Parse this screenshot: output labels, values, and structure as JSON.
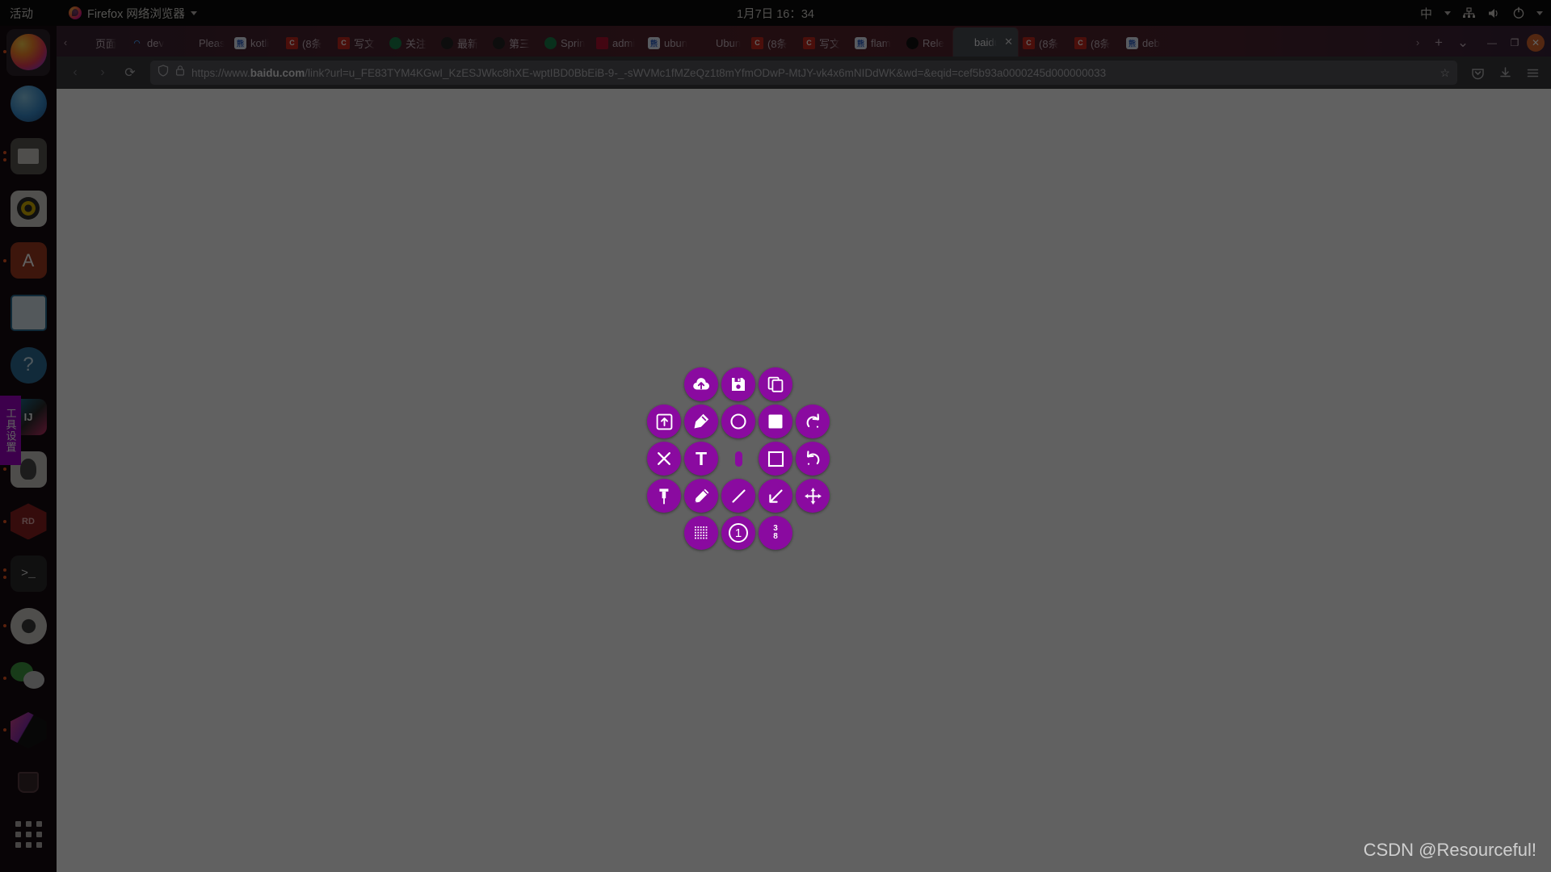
{
  "topbar": {
    "activities": "活动",
    "app_name": "Firefox 网络浏览器",
    "clock": "1月7日  16：34",
    "input_method": "中",
    "icons": [
      "network-icon",
      "volume-icon",
      "power-icon",
      "chevron-down-icon"
    ]
  },
  "dock": {
    "tool_tag": "工具设置",
    "items": [
      {
        "name": "firefox",
        "label": "Firefox"
      },
      {
        "name": "thunderbird",
        "label": "Thunderbird"
      },
      {
        "name": "files",
        "label": "Files"
      },
      {
        "name": "rhythmbox",
        "label": "Rhythmbox"
      },
      {
        "name": "ubuntu-software",
        "label": "Ubuntu Software"
      },
      {
        "name": "libreoffice-impress",
        "label": "LibreOffice Impress"
      },
      {
        "name": "help",
        "label": "Help"
      },
      {
        "name": "intellij-idea",
        "label": "IntelliJ IDEA"
      },
      {
        "name": "dbeaver",
        "label": "DBeaver"
      },
      {
        "name": "redis-desktop-manager",
        "label": "RDM"
      },
      {
        "name": "terminal",
        "label": "Terminal"
      },
      {
        "name": "settings",
        "label": "Settings"
      },
      {
        "name": "wechat",
        "label": "WeChat"
      },
      {
        "name": "virtualbox",
        "label": "VirtualBox"
      },
      {
        "name": "trash",
        "label": "Trash"
      },
      {
        "name": "show-applications",
        "label": "Show Applications"
      }
    ]
  },
  "browser": {
    "tabs": [
      {
        "label": "页面",
        "favicon": "none",
        "selected": false
      },
      {
        "label": "dev",
        "favicon": "load",
        "selected": false
      },
      {
        "label": "Please s",
        "favicon": "none",
        "selected": false
      },
      {
        "label": "kotli",
        "favicon": "baidu",
        "selected": false
      },
      {
        "label": "(8条",
        "favicon": "csdn",
        "selected": false
      },
      {
        "label": "写文",
        "favicon": "csdn",
        "selected": false
      },
      {
        "label": "关注",
        "favicon": "green",
        "selected": false
      },
      {
        "label": "最新",
        "favicon": "dark",
        "selected": false
      },
      {
        "label": "第三",
        "favicon": "dark",
        "selected": false
      },
      {
        "label": "Sprin",
        "favicon": "green",
        "selected": false
      },
      {
        "label": "admi",
        "favicon": "red",
        "selected": false
      },
      {
        "label": "ubun",
        "favicon": "baidu",
        "selected": false
      },
      {
        "label": "Ubun",
        "favicon": "none",
        "selected": false
      },
      {
        "label": "(8条",
        "favicon": "csdn",
        "selected": false
      },
      {
        "label": "写文",
        "favicon": "csdn",
        "selected": false
      },
      {
        "label": "flam",
        "favicon": "baidu",
        "selected": false
      },
      {
        "label": "Rele",
        "favicon": "gh",
        "selected": false
      },
      {
        "label": "baidu",
        "favicon": "none",
        "selected": true,
        "close": "✕"
      },
      {
        "label": "(8条",
        "favicon": "csdn",
        "selected": false
      },
      {
        "label": "(8条",
        "favicon": "csdn",
        "selected": false
      },
      {
        "label": "deb",
        "favicon": "baidu",
        "selected": false
      }
    ],
    "new_tab_label": "+",
    "list_all_tabs_label": "⌄",
    "window_controls": {
      "minimize": "—",
      "maximize": "❐",
      "close": "✕"
    },
    "nav": {
      "back": "‹",
      "forward": "›",
      "reload": "⟳",
      "shield_icon": "shield-icon",
      "lock_icon": "lock-icon",
      "url_prefix": "https://www.",
      "url_domain": "baidu.com",
      "url_rest": "/link?url=u_FE83TYM4KGwI_KzESJWkc8hXE-wptIBD0BbEiB-9-_-sWVMc1fMZeQz1t8mYfmODwP-MtJY-vk4x6mNIDdWK&wd=&eqid=cef5b93a0000245d000000033",
      "bookmark_star": "☆",
      "pocket_icon": "pocket-icon",
      "downloads_icon": "download-icon",
      "menu_icon": "hamburger-menu-icon"
    }
  },
  "toolmenu": {
    "accent_color": "#8a0aa0",
    "buttons": [
      {
        "row": 1,
        "name": "upload-to-cloud-button",
        "icon": "cloud-upload-icon"
      },
      {
        "row": 1,
        "name": "save-button",
        "icon": "floppy-save-icon"
      },
      {
        "row": 1,
        "name": "copy-button",
        "icon": "copy-icon"
      },
      {
        "row": 2,
        "name": "open-app-button",
        "icon": "open-in-app-icon"
      },
      {
        "row": 2,
        "name": "marker-button",
        "icon": "marker-highlighter-icon"
      },
      {
        "row": 2,
        "name": "circle-button",
        "icon": "circle-outline-icon"
      },
      {
        "row": 2,
        "name": "filled-rect-button",
        "icon": "filled-square-icon"
      },
      {
        "row": 2,
        "name": "redo-button",
        "icon": "redo-arrow-icon"
      },
      {
        "row": 3,
        "name": "exit-button",
        "icon": "close-x-icon"
      },
      {
        "row": 3,
        "name": "text-button",
        "icon": "text-t-icon"
      },
      {
        "row": 3,
        "name": "blur-button",
        "icon": "pill-blur-icon"
      },
      {
        "row": 3,
        "name": "rectangle-button",
        "icon": "square-outline-icon"
      },
      {
        "row": 3,
        "name": "undo-button",
        "icon": "undo-arrow-icon"
      },
      {
        "row": 4,
        "name": "pin-button",
        "icon": "pin-icon"
      },
      {
        "row": 4,
        "name": "pencil-button",
        "icon": "pencil-icon"
      },
      {
        "row": 4,
        "name": "line-button",
        "icon": "line-icon"
      },
      {
        "row": 4,
        "name": "arrow-button",
        "icon": "arrow-down-left-icon"
      },
      {
        "row": 4,
        "name": "move-selection-button",
        "icon": "move-arrows-icon"
      },
      {
        "row": 5,
        "name": "pixelate-button",
        "icon": "mosaic-grid-icon"
      },
      {
        "row": 5,
        "name": "counter-button",
        "icon": "circled-one-icon",
        "label": "1"
      },
      {
        "row": 5,
        "name": "size-indicator-button",
        "icon": "fraction-icon",
        "numerator": "3",
        "denominator": "8"
      }
    ]
  },
  "watermark": "CSDN @Resourceful!"
}
